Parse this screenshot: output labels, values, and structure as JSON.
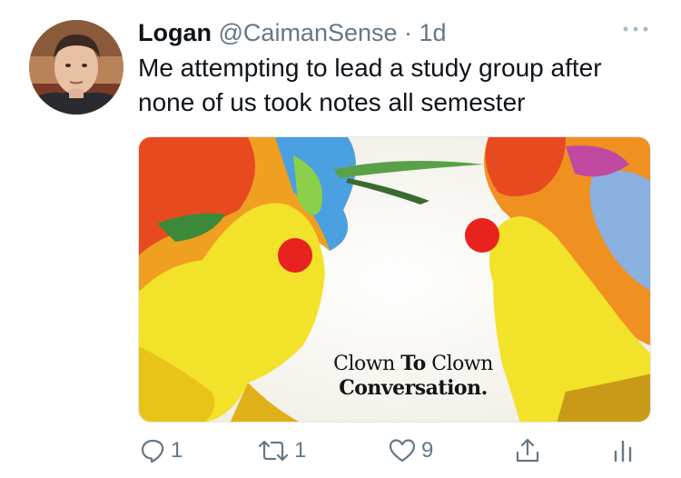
{
  "author": {
    "name": "Logan",
    "handle": "@CaimanSense",
    "separator": " · ",
    "time": "1d"
  },
  "tweet": {
    "text": "Me attempting to lead a study group after none of us took notes all semester"
  },
  "media": {
    "caption_word1": "Clown ",
    "caption_word2": "To",
    "caption_word3": " Clown",
    "caption_line2": "Conversation."
  },
  "actions": {
    "reply_count": "1",
    "retweet_count": "1",
    "like_count": "9"
  },
  "icons": {
    "more": "more-dots-icon",
    "reply": "reply-icon",
    "retweet": "retweet-icon",
    "like": "heart-icon",
    "share": "share-icon",
    "analytics": "analytics-icon"
  },
  "colors": {
    "text": "#0f1419",
    "secondary": "#657786"
  }
}
